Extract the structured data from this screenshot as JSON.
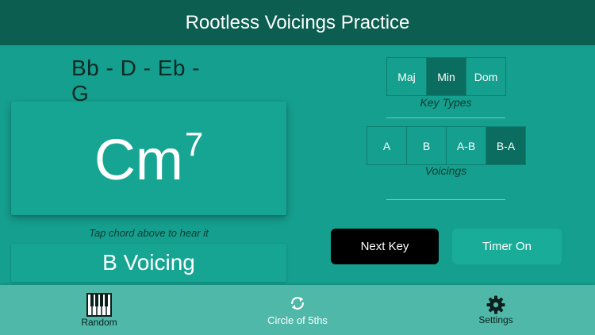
{
  "header": {
    "title": "Rootless Voicings Practice"
  },
  "notes": "Bb - D - Eb - G",
  "chord": {
    "root": "Cm",
    "extension": "7"
  },
  "hint": "Tap chord above to hear it",
  "voicing_display": "B Voicing",
  "key_types": {
    "options": [
      "Maj",
      "Min",
      "Dom"
    ],
    "selected": "Min",
    "caption": "Key Types"
  },
  "voicings": {
    "options": [
      "A",
      "B",
      "A-B",
      "B-A"
    ],
    "selected": "B-A",
    "caption": "Voicings"
  },
  "buttons": {
    "next_key": "Next Key",
    "timer": "Timer On"
  },
  "tabbar": {
    "random": {
      "label": "Random",
      "icon": "piano-icon"
    },
    "circle": {
      "label": "Circle of 5ths",
      "icon": "refresh-icon"
    },
    "settings": {
      "label": "Settings",
      "icon": "gear-icon"
    }
  },
  "colors": {
    "background": "#159f8e",
    "header": "#0b5e50",
    "selected_segment": "#0b6d5f",
    "tabbar": "#4fb8a9",
    "next_button": "#000000"
  }
}
